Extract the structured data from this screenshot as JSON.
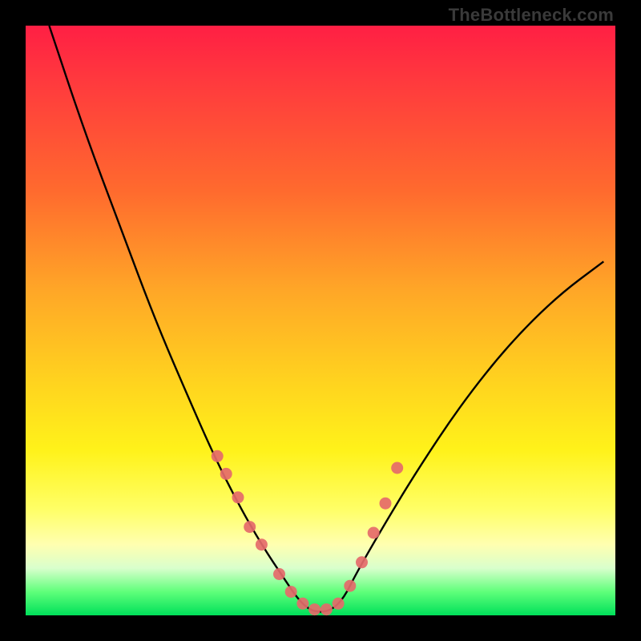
{
  "attribution": "TheBottleneck.com",
  "chart_data": {
    "type": "line",
    "title": "",
    "xlabel": "",
    "ylabel": "",
    "xlim": [
      0,
      100
    ],
    "ylim": [
      0,
      100
    ],
    "series": [
      {
        "name": "bottleneck-curve",
        "x": [
          4,
          10,
          16,
          22,
          28,
          32,
          36,
          40,
          44,
          46,
          48,
          50,
          52,
          54,
          56,
          60,
          66,
          74,
          82,
          90,
          98
        ],
        "y": [
          100,
          82,
          66,
          50,
          36,
          27,
          19,
          12,
          6,
          3,
          1,
          0.5,
          1,
          3,
          7,
          14,
          24,
          36,
          46,
          54,
          60
        ]
      }
    ],
    "markers": {
      "name": "highlight-dots",
      "color": "#e56a6a",
      "x": [
        32.5,
        34,
        36,
        38,
        40,
        43,
        45,
        47,
        49,
        51,
        53,
        55,
        57,
        59,
        61,
        63
      ],
      "y": [
        27,
        24,
        20,
        15,
        12,
        7,
        4,
        2,
        1,
        1,
        2,
        5,
        9,
        14,
        19,
        25
      ]
    }
  }
}
